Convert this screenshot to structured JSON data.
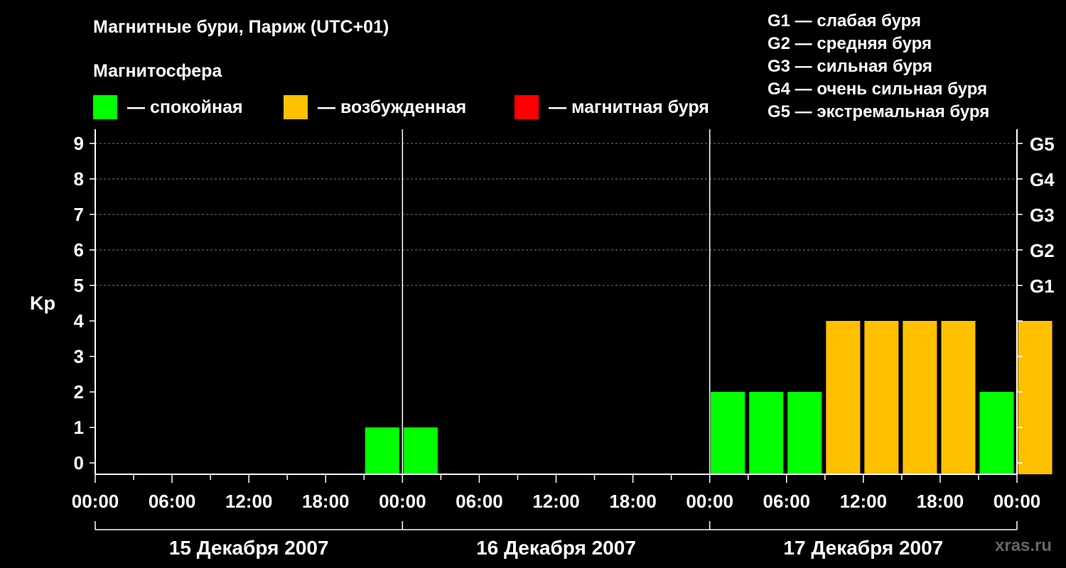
{
  "title": "Магнитные бури, Париж (UTC+01)",
  "subtitle": "Магнитосфера",
  "legend": [
    {
      "name": "legend-calm",
      "color": "#00ff00",
      "label": "— спокойная"
    },
    {
      "name": "legend-excited",
      "color": "#ffc000",
      "label": "— возбужденная"
    },
    {
      "name": "legend-storm",
      "color": "#ff0000",
      "label": "— магнитная буря"
    }
  ],
  "g_legend": [
    "G1 — слабая буря",
    "G2 — средняя буря",
    "G3 — сильная буря",
    "G4 — очень сильная буря",
    "G5 — экстремальная буря"
  ],
  "watermark": "xras.ru",
  "chart_data": {
    "type": "bar",
    "ylabel": "Kp",
    "ylim": [
      0,
      9
    ],
    "yticks": [
      0,
      1,
      2,
      3,
      4,
      5,
      6,
      7,
      8,
      9
    ],
    "g_ticks": [
      {
        "value": 5,
        "label": "G1"
      },
      {
        "value": 6,
        "label": "G2"
      },
      {
        "value": 7,
        "label": "G3"
      },
      {
        "value": 8,
        "label": "G4"
      },
      {
        "value": 9,
        "label": "G5"
      }
    ],
    "x_tick_labels": [
      "00:00",
      "06:00",
      "12:00",
      "18:00",
      "00:00",
      "06:00",
      "12:00",
      "18:00",
      "00:00",
      "06:00",
      "12:00",
      "18:00",
      "00:00"
    ],
    "days": [
      "15 Декабря 2007",
      "16 Декабря 2007",
      "17 Декабря 2007"
    ],
    "bar_interval_hours": 3,
    "values": [
      0,
      0,
      0,
      0,
      0,
      0,
      0,
      1,
      1,
      0,
      0,
      0,
      0,
      0,
      0,
      0,
      2,
      2,
      2,
      4,
      4,
      4,
      4,
      2,
      4
    ],
    "colors": {
      "calm": "#00ff00",
      "excited": "#ffc000",
      "storm": "#ff0000"
    },
    "grid": true,
    "grid_values": [
      5,
      6,
      7,
      8,
      9
    ]
  }
}
